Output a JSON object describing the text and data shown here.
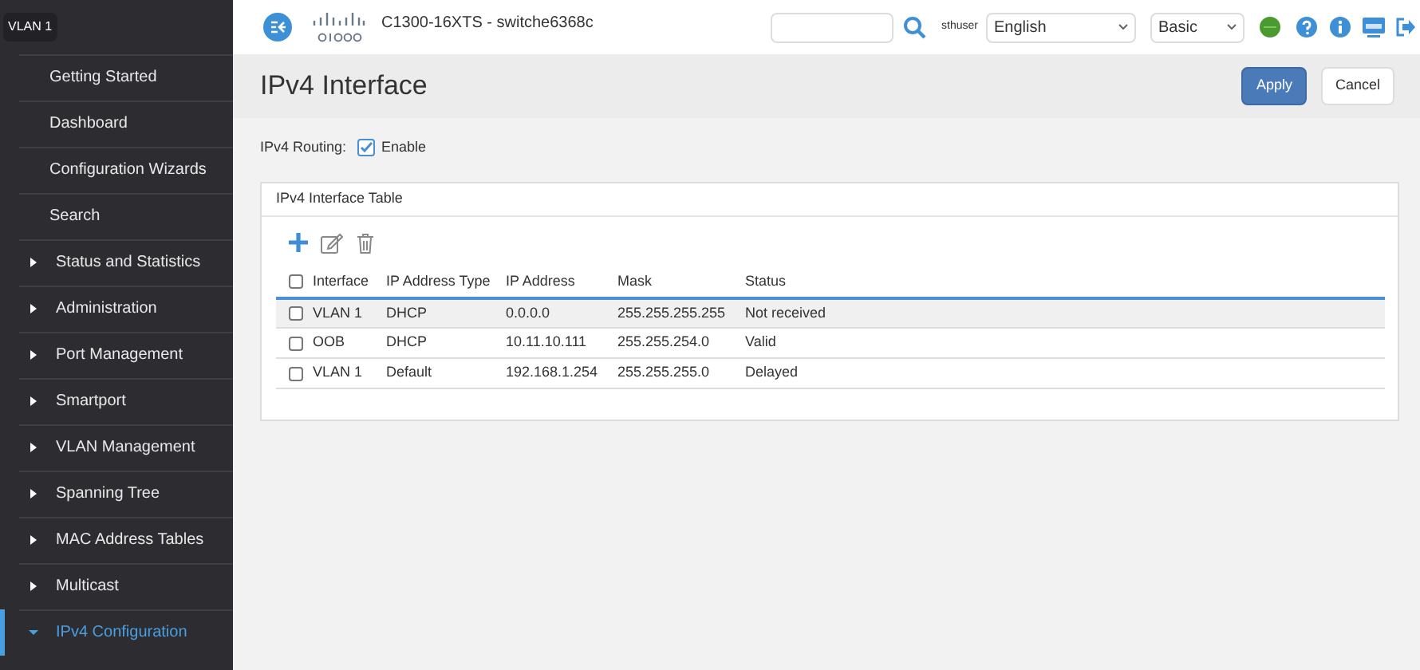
{
  "sidebar": {
    "badge": "VLAN 1",
    "items": [
      {
        "label": "Getting Started",
        "kind": "link"
      },
      {
        "label": "Dashboard",
        "kind": "link"
      },
      {
        "label": "Configuration Wizards",
        "kind": "link"
      },
      {
        "label": "Search",
        "kind": "link"
      },
      {
        "label": "Status and Statistics",
        "kind": "group",
        "expanded": false
      },
      {
        "label": "Administration",
        "kind": "group",
        "expanded": false
      },
      {
        "label": "Port Management",
        "kind": "group",
        "expanded": false
      },
      {
        "label": "Smartport",
        "kind": "group",
        "expanded": false
      },
      {
        "label": "VLAN Management",
        "kind": "group",
        "expanded": false
      },
      {
        "label": "Spanning Tree",
        "kind": "group",
        "expanded": false
      },
      {
        "label": "MAC Address Tables",
        "kind": "group",
        "expanded": false
      },
      {
        "label": "Multicast",
        "kind": "group",
        "expanded": false
      },
      {
        "label": "IPv4 Configuration",
        "kind": "group",
        "expanded": true
      }
    ]
  },
  "header": {
    "device": "C1300-16XTS - switche6368c",
    "user": "sthuser",
    "language": "English",
    "mode": "Basic"
  },
  "page": {
    "title": "IPv4 Interface",
    "buttons": [
      "Apply",
      "Cancel"
    ],
    "routing": {
      "label": "IPv4 Routing:",
      "option": "Enable",
      "checked": true
    }
  },
  "table": {
    "title": "IPv4 Interface Table",
    "all_checked": false,
    "columns": [
      "Interface",
      "IP Address Type",
      "IP Address",
      "Mask",
      "Status"
    ],
    "rows": [
      {
        "cells": [
          "VLAN 1",
          "DHCP",
          "0.0.0.0",
          "255.255.255.255",
          "Not received"
        ],
        "checked": false,
        "highlighted": true
      },
      {
        "cells": [
          "OOB",
          "DHCP",
          "10.11.10.111",
          "255.255.254.0",
          "Valid"
        ],
        "checked": false,
        "highlighted": false
      },
      {
        "cells": [
          "VLAN 1",
          "Default",
          "192.168.1.254",
          "255.255.255.0",
          "Delayed"
        ],
        "checked": false,
        "highlighted": false
      }
    ]
  }
}
